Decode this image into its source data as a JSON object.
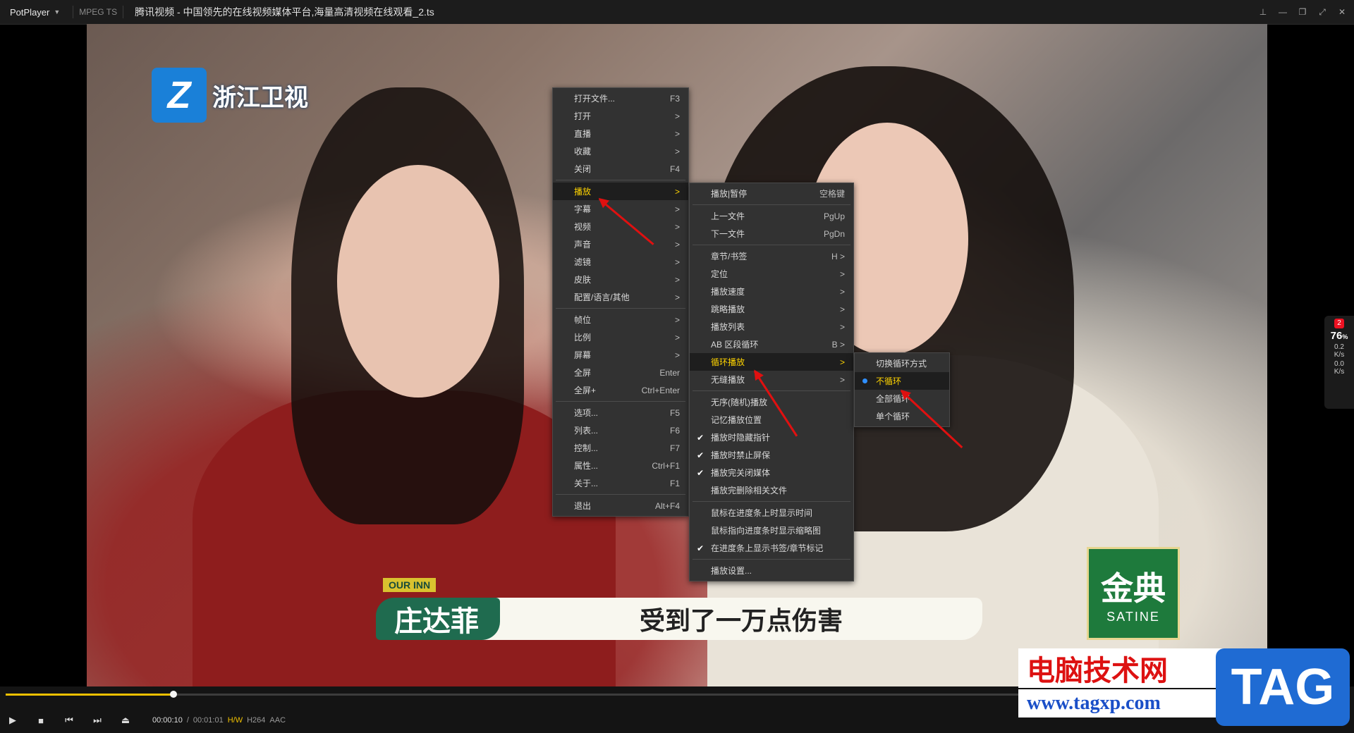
{
  "titlebar": {
    "app": "PotPlayer",
    "codec": "MPEG TS",
    "title": "腾讯视频 - 中国领先的在线视频媒体平台,海量高清视频在线观看_2.ts"
  },
  "video": {
    "channel_logo_text": "浙江卫视",
    "caption_tag": "OUR INN",
    "caption_name": "庄达菲",
    "caption_text": "受到了一万点伤害",
    "brand_line1": "金典",
    "brand_line2": "SATINE"
  },
  "main_menu": [
    {
      "label": "打开文件...",
      "shortcut": "F3"
    },
    {
      "label": "打开",
      "shortcut": ">"
    },
    {
      "label": "直播",
      "shortcut": ">"
    },
    {
      "label": "收藏",
      "shortcut": ">"
    },
    {
      "label": "关闭",
      "shortcut": "F4"
    },
    {
      "sep": true
    },
    {
      "label": "播放",
      "shortcut": ">",
      "highlight": true
    },
    {
      "label": "字幕",
      "shortcut": ">"
    },
    {
      "label": "视频",
      "shortcut": ">"
    },
    {
      "label": "声音",
      "shortcut": ">"
    },
    {
      "label": "滤镜",
      "shortcut": ">"
    },
    {
      "label": "皮肤",
      "shortcut": ">"
    },
    {
      "label": "配置/语言/其他",
      "shortcut": ">"
    },
    {
      "sep": true
    },
    {
      "label": "帧位",
      "shortcut": ">"
    },
    {
      "label": "比例",
      "shortcut": ">"
    },
    {
      "label": "屏幕",
      "shortcut": ">"
    },
    {
      "label": "全屏",
      "shortcut": "Enter"
    },
    {
      "label": "全屏+",
      "shortcut": "Ctrl+Enter"
    },
    {
      "sep": true
    },
    {
      "label": "选项...",
      "shortcut": "F5"
    },
    {
      "label": "列表...",
      "shortcut": "F6"
    },
    {
      "label": "控制...",
      "shortcut": "F7"
    },
    {
      "label": "属性...",
      "shortcut": "Ctrl+F1"
    },
    {
      "label": "关于...",
      "shortcut": "F1"
    },
    {
      "sep": true
    },
    {
      "label": "退出",
      "shortcut": "Alt+F4"
    }
  ],
  "play_menu": [
    {
      "label": "播放|暂停",
      "shortcut": "空格键"
    },
    {
      "sep": true
    },
    {
      "label": "上一文件",
      "shortcut": "PgUp"
    },
    {
      "label": "下一文件",
      "shortcut": "PgDn"
    },
    {
      "sep": true
    },
    {
      "label": "章节/书签",
      "shortcut": "H >"
    },
    {
      "label": "定位",
      "shortcut": ">"
    },
    {
      "label": "播放速度",
      "shortcut": ">"
    },
    {
      "label": "跳略播放",
      "shortcut": ">"
    },
    {
      "label": "播放列表",
      "shortcut": ">"
    },
    {
      "label": "AB 区段循环",
      "shortcut": "B >"
    },
    {
      "label": "循环播放",
      "shortcut": ">",
      "highlight": true
    },
    {
      "label": "无缝播放",
      "shortcut": ">"
    },
    {
      "sep": true
    },
    {
      "label": "无序(随机)播放",
      "shortcut": ""
    },
    {
      "label": "记忆播放位置",
      "shortcut": ""
    },
    {
      "label": "播放时隐藏指针",
      "shortcut": "",
      "checked": true
    },
    {
      "label": "播放时禁止屏保",
      "shortcut": "",
      "checked": true
    },
    {
      "label": "播放完关闭媒体",
      "shortcut": "",
      "checked": true
    },
    {
      "label": "播放完删除相关文件",
      "shortcut": ""
    },
    {
      "sep": true
    },
    {
      "label": "鼠标在进度条上时显示时间",
      "shortcut": ""
    },
    {
      "label": "鼠标指向进度条时显示缩略图",
      "shortcut": ""
    },
    {
      "label": "在进度条上显示书签/章节标记",
      "shortcut": "",
      "checked": true
    },
    {
      "sep": true
    },
    {
      "label": "播放设置...",
      "shortcut": ""
    }
  ],
  "loop_menu": [
    {
      "label": "切换循环方式",
      "shortcut": ""
    },
    {
      "label": "不循环",
      "shortcut": "",
      "radio": true,
      "highlight": true
    },
    {
      "label": "全部循环",
      "shortcut": ""
    },
    {
      "label": "单个循环",
      "shortcut": ""
    }
  ],
  "side_widget": {
    "badge": "2",
    "percent": "76",
    "percent_unit": "%",
    "up_rate": "0.2",
    "up_unit": "K/s",
    "down_rate": "0.0",
    "down_unit": "K/s"
  },
  "player": {
    "position": "00:00:10",
    "duration": "00:01:01",
    "hw": "H/W",
    "video_codec": "H264",
    "audio_codec": "AAC",
    "progress": 0.164
  },
  "watermark": {
    "site_cn": "电脑技术网",
    "site_url": "www.tagxp.com",
    "tag": "TAG"
  },
  "colors": {
    "accent_yellow": "#ffd400",
    "menu_bg": "#323232",
    "arrow_red": "#e01010",
    "radio_blue": "#2f8fff"
  }
}
